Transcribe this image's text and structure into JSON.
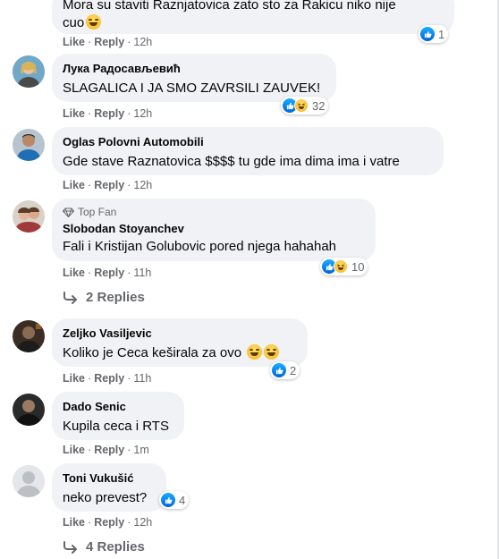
{
  "actions": {
    "like": "Like",
    "reply": "Reply",
    "separator": "·"
  },
  "comments": [
    {
      "author": "",
      "lines": [
        "Mora su staviti Raznjatovica zato sto za Rakicu niko nije",
        "cuo"
      ],
      "time": "12h",
      "reactions": {
        "types": [
          "like"
        ],
        "count": "1"
      }
    },
    {
      "author": "Лука Радосављевић",
      "lines": [
        "SLAGALICA I JA SMO ZAVRSILI ZAUVEK!"
      ],
      "time": "12h",
      "reactions": {
        "types": [
          "like",
          "haha"
        ],
        "count": "32"
      }
    },
    {
      "author": "Oglas Polovni Automobili",
      "lines": [
        "Gde stave Raznatovica $$$$ tu gde ima dima ima i vatre"
      ],
      "time": "12h"
    },
    {
      "badge": "Top Fan",
      "author": "Slobodan Stoyanchev",
      "lines": [
        "Fali i Kristijan Golubovic pored njega hahahah"
      ],
      "time": "11h",
      "reactions": {
        "types": [
          "like",
          "haha"
        ],
        "count": "10"
      },
      "replies": "2 Replies"
    },
    {
      "author": "Zeljko Vasiljevic",
      "lines": [
        "Koliko je Ceca keširala za ovo"
      ],
      "time": "11h",
      "reactions": {
        "types": [
          "like"
        ],
        "count": "2"
      }
    },
    {
      "author": "Dado Senic",
      "lines": [
        "Kupila ceca i RTS"
      ],
      "time": "1m"
    },
    {
      "author": "Toni Vukušić",
      "lines": [
        "neko prevest?"
      ],
      "time": "12h",
      "reactions": {
        "types": [
          "like"
        ],
        "count": "4"
      },
      "replies": "4 Replies"
    }
  ],
  "colors": {
    "bubble": "#f0f2f5",
    "muted": "#65676b",
    "like": "#1877f2",
    "haha": "#f7b125"
  }
}
